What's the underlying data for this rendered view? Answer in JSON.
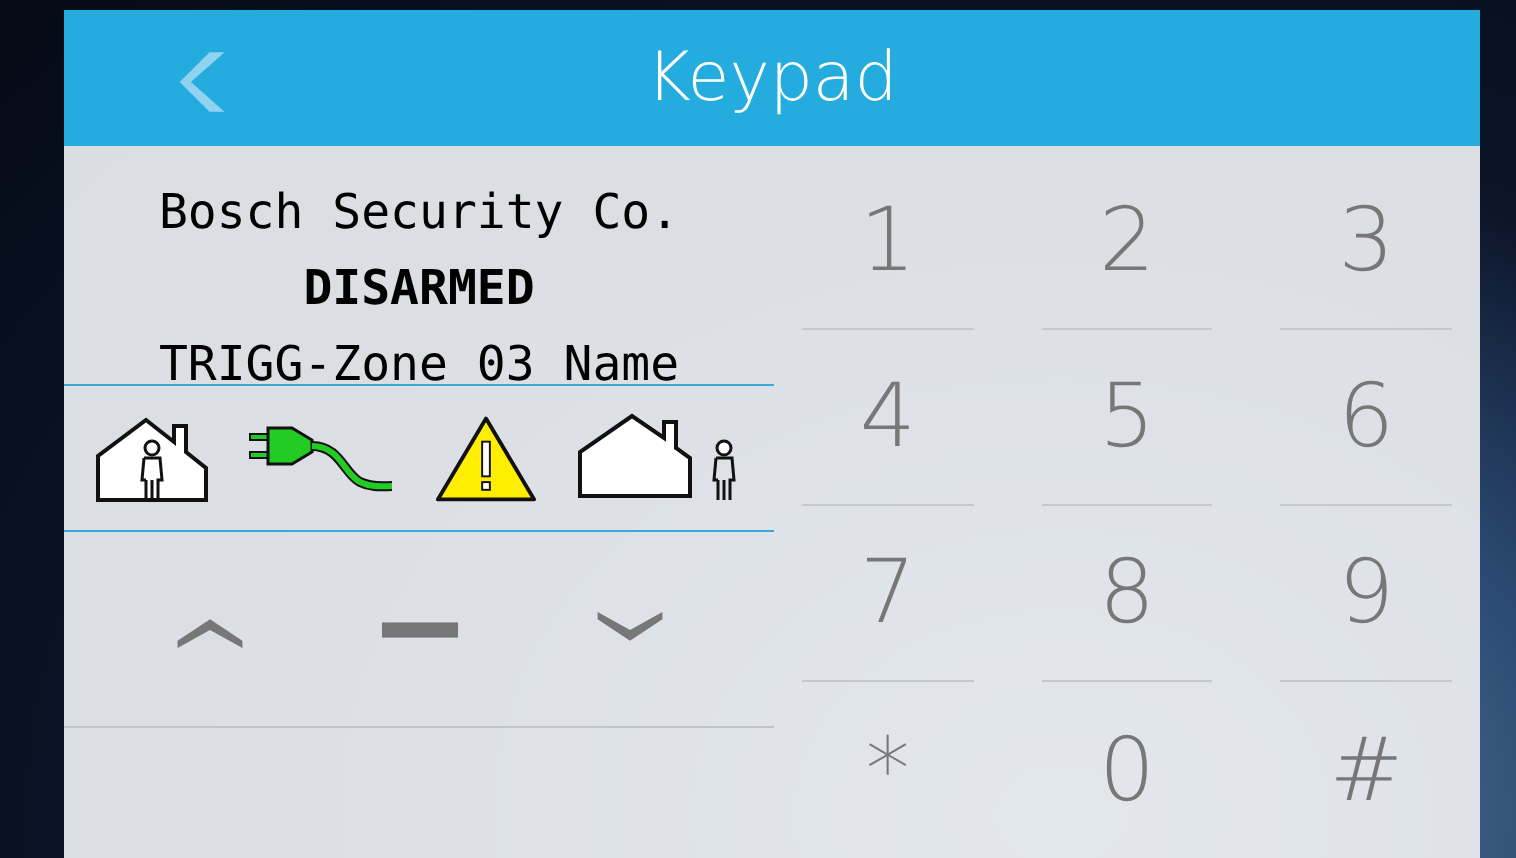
{
  "header": {
    "title": "Keypad"
  },
  "display": {
    "lines": [
      {
        "text": "Bosch Security Co.",
        "bold": false
      },
      {
        "text": "DISARMED",
        "bold": true
      },
      {
        "text": "TRIGG-Zone 03 Name",
        "bold": false
      }
    ],
    "status_icons": [
      {
        "kind": "home"
      },
      {
        "kind": "power"
      },
      {
        "kind": "warning"
      },
      {
        "kind": "outside"
      }
    ]
  },
  "scroll_buttons": [
    {
      "kind": "up"
    },
    {
      "kind": "dash"
    },
    {
      "kind": "down"
    }
  ],
  "keys": [
    "1",
    "2",
    "3",
    "4",
    "5",
    "6",
    "7",
    "8",
    "9",
    "*",
    "0",
    "#"
  ]
}
